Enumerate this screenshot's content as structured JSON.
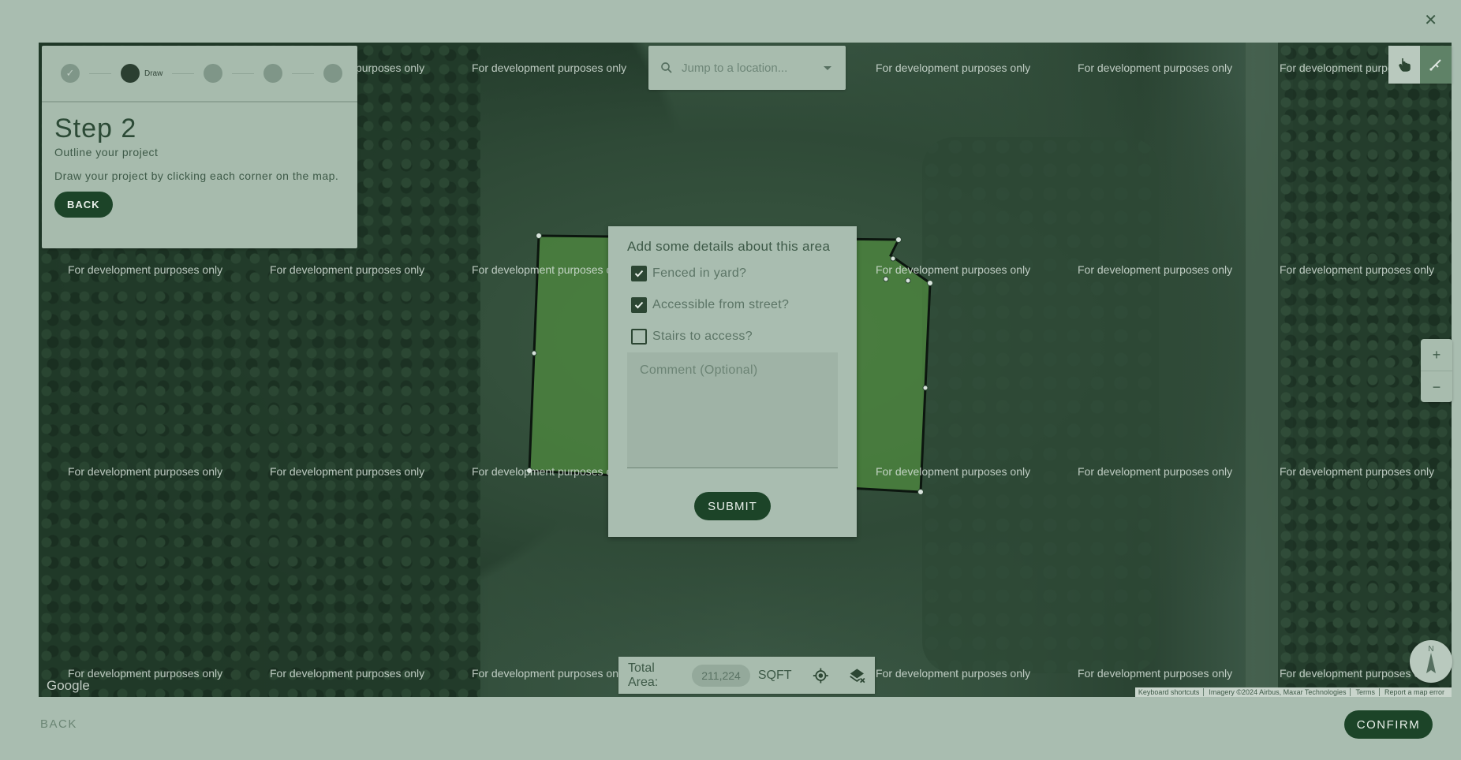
{
  "close_icon": "close-icon",
  "stepper": {
    "active_label": "Draw",
    "steps": [
      {
        "state": "done",
        "icon": "check-icon"
      },
      {
        "state": "active"
      },
      {
        "state": "todo"
      },
      {
        "state": "todo"
      },
      {
        "state": "todo"
      }
    ]
  },
  "step_panel": {
    "title": "Step 2",
    "subtitle": "Outline your project",
    "description": "Draw your project by clicking each corner on the map.",
    "back_label": "BACK"
  },
  "search": {
    "placeholder": "Jump to a location..."
  },
  "watermark_text": "For development purposes only",
  "map": {
    "google_label": "Google",
    "attribution": [
      "Keyboard shortcuts",
      "Imagery ©2024 Airbus, Maxar Technologies",
      "Terms",
      "Report a map error"
    ],
    "zoom_in": "+",
    "zoom_out": "−",
    "compass_label": "N"
  },
  "area_bar": {
    "label": "Total Area:",
    "value": "211,224",
    "unit": "SQFT"
  },
  "modal": {
    "title": "Add some details about this area",
    "options": [
      {
        "label": "Fenced in yard?",
        "checked": true
      },
      {
        "label": "Accessible from street?",
        "checked": true
      },
      {
        "label": "Stairs to access?",
        "checked": false
      }
    ],
    "comment_placeholder": "Comment (Optional)",
    "submit_label": "SUBMIT"
  },
  "footer": {
    "back_label": "BACK",
    "confirm_label": "CONFIRM"
  },
  "colors": {
    "primary": "#1c4428",
    "overlay": "#a9bdb0"
  }
}
